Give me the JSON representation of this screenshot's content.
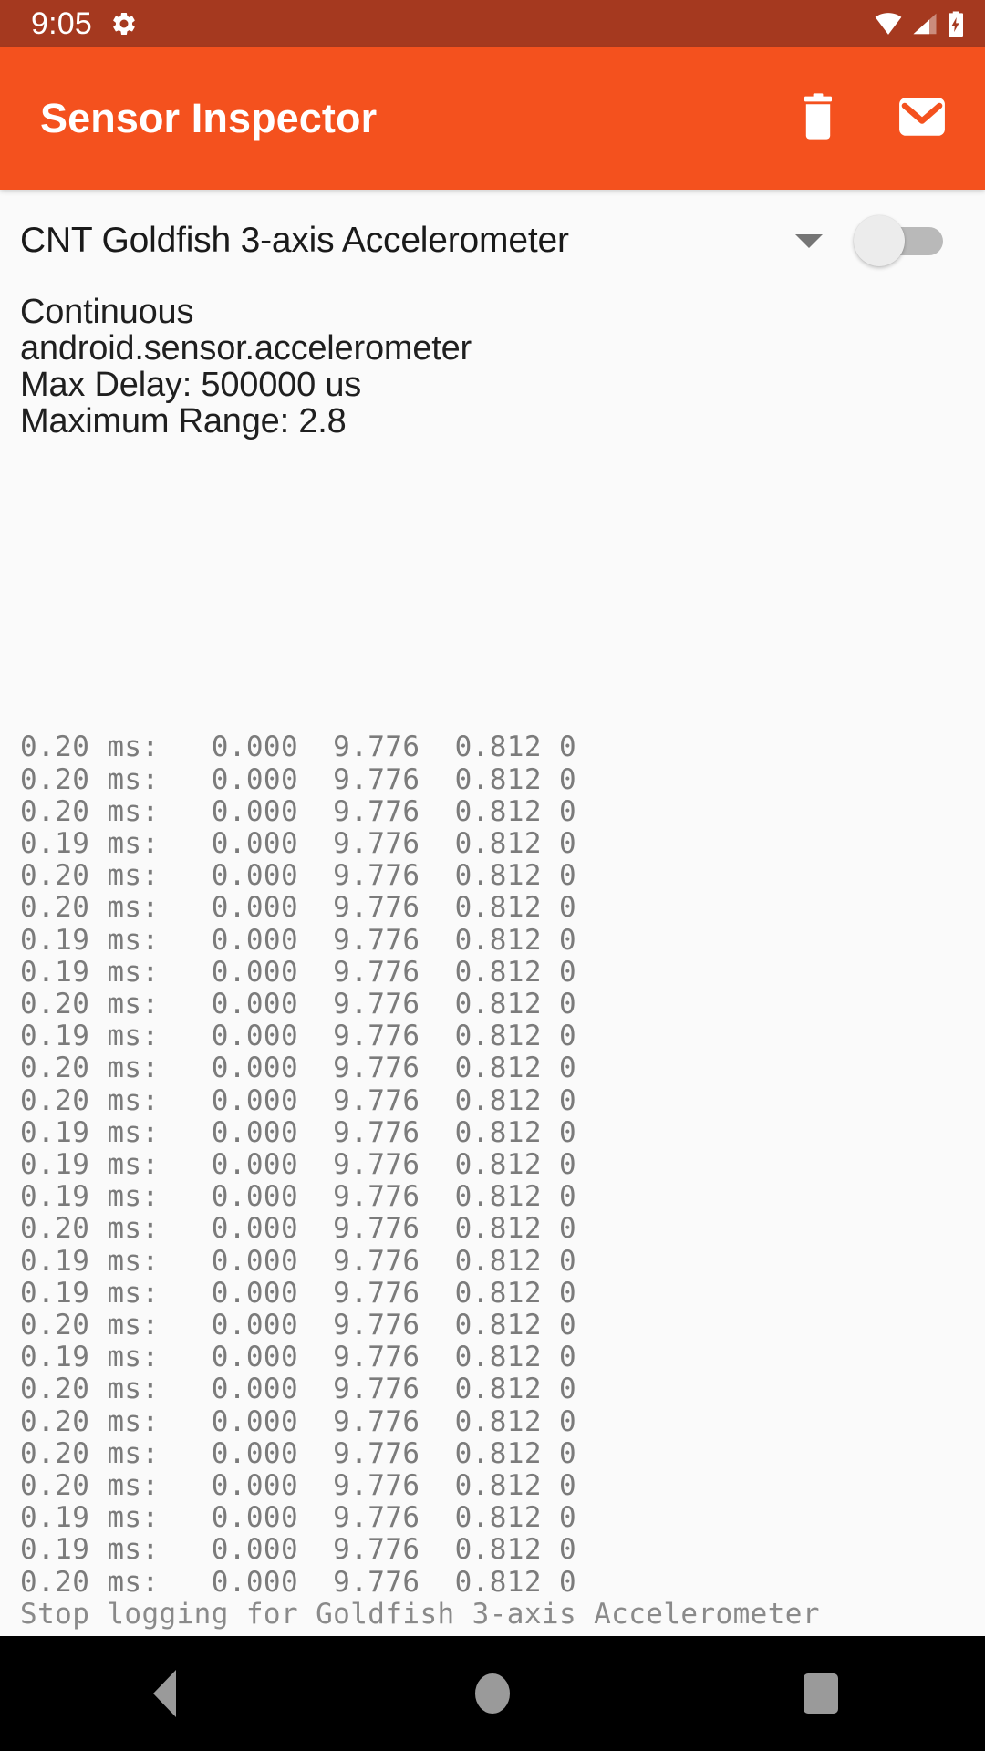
{
  "colors": {
    "status_bar_bg": "#A5391F",
    "app_bar_bg": "#F4511E",
    "content_bg": "#FAFAFA",
    "nav_bar_bg": "#000000",
    "log_text": "#7B7B7B",
    "info_text": "#1F1F1F"
  },
  "status_bar": {
    "clock": "9:05",
    "icons": [
      "gear-icon",
      "wifi-icon",
      "cell-signal-icon",
      "battery-charging-icon"
    ]
  },
  "app_bar": {
    "title": "Sensor Inspector",
    "actions": [
      {
        "name": "delete-log-button",
        "icon": "trash-icon"
      },
      {
        "name": "email-log-button",
        "icon": "envelope-icon"
      }
    ]
  },
  "sensor_selector": {
    "selected": "CNT Goldfish 3-axis Accelerometer",
    "caret_icon": "chevron-down-icon",
    "switch": {
      "label": "logging-toggle",
      "checked": false
    }
  },
  "sensor_info": {
    "reporting_mode": "Continuous",
    "type_string": "android.sensor.accelerometer",
    "max_delay": "Max Delay: 500000 us",
    "maximum_range": "Maximum Range: 2.8"
  },
  "log": {
    "lines": [
      "0.20 ms:   0.000  9.776  0.812 0",
      "0.20 ms:   0.000  9.776  0.812 0",
      "0.20 ms:   0.000  9.776  0.812 0",
      "0.19 ms:   0.000  9.776  0.812 0",
      "0.20 ms:   0.000  9.776  0.812 0",
      "0.20 ms:   0.000  9.776  0.812 0",
      "0.19 ms:   0.000  9.776  0.812 0",
      "0.19 ms:   0.000  9.776  0.812 0",
      "0.20 ms:   0.000  9.776  0.812 0",
      "0.19 ms:   0.000  9.776  0.812 0",
      "0.20 ms:   0.000  9.776  0.812 0",
      "0.20 ms:   0.000  9.776  0.812 0",
      "0.19 ms:   0.000  9.776  0.812 0",
      "0.19 ms:   0.000  9.776  0.812 0",
      "0.19 ms:   0.000  9.776  0.812 0",
      "0.20 ms:   0.000  9.776  0.812 0",
      "0.19 ms:   0.000  9.776  0.812 0",
      "0.19 ms:   0.000  9.776  0.812 0",
      "0.20 ms:   0.000  9.776  0.812 0",
      "0.19 ms:   0.000  9.776  0.812 0",
      "0.20 ms:   0.000  9.776  0.812 0",
      "0.20 ms:   0.000  9.776  0.812 0",
      "0.20 ms:   0.000  9.776  0.812 0",
      "0.20 ms:   0.000  9.776  0.812 0",
      "0.19 ms:   0.000  9.776  0.812 0",
      "0.19 ms:   0.000  9.776  0.812 0",
      "0.20 ms:   0.000  9.776  0.812 0"
    ],
    "status_line": "Stop logging for Goldfish 3-axis Accelerometer"
  },
  "nav_bar": {
    "buttons": [
      {
        "name": "nav-back-button",
        "icon": "triangle-back-icon"
      },
      {
        "name": "nav-home-button",
        "icon": "circle-home-icon"
      },
      {
        "name": "nav-recents-button",
        "icon": "square-recents-icon"
      }
    ]
  }
}
